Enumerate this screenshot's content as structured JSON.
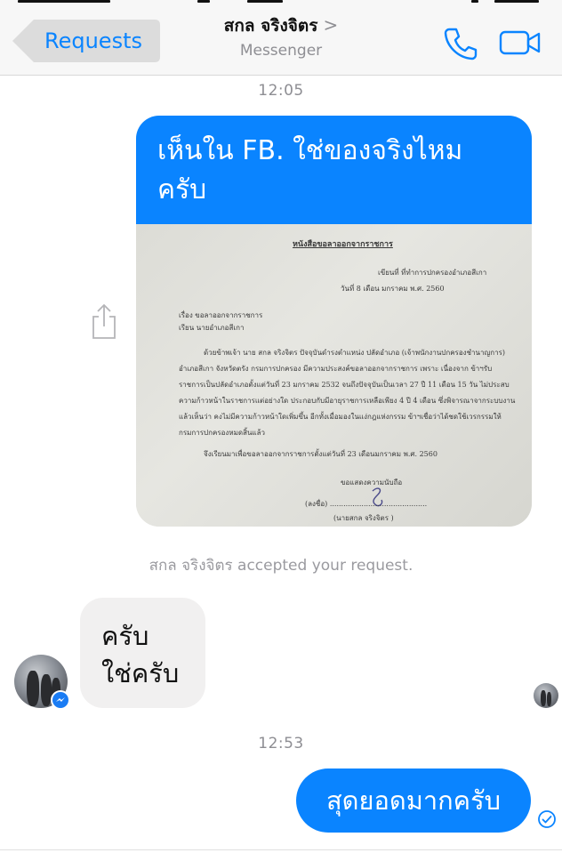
{
  "navbar": {
    "back_label": "Requests",
    "contact_name": "สกล จริงจิตร",
    "chevron": ">",
    "subtitle": "Messenger",
    "call_icon": "phone-icon",
    "video_icon": "video-camera-icon"
  },
  "conversation": {
    "timestamp_1": "12:05",
    "photo_message": {
      "caption": "เห็นใน FB. ใช่ของจริงไหมครับ",
      "document_lines": [
        "หนังสือขอลาออกจากราชการ",
        "เขียนที่ ที่ทำการปกครองอำเภอสีเกา",
        "วันที่ 8 เดือน มกราคม พ.ศ. 2560",
        "เรื่อง  ขอลาออกจากราชการ",
        "เรียน  นายอำเภอสีเกา",
        "ด้วยข้าพเจ้า นาย สกล จริงจิตร ปัจจุบันดำรงตำแหน่ง ปลัดอำเภอ (เจ้าพนักงานปกครองชำนาญการ)",
        "อำเภอสีเกา จังหวัดตรัง กรมการปกครอง  มีความประสงค์ขอลาออกจากราชการ  เพราะ เนื่องจาก ข้าฯรับ",
        "ราชการเป็นปลัดอำเภอตั้งแต่วันที่ 23 มกราคม 2532 จนถึงปัจจุบันเป็นเวลา 27 ปี 11 เดือน 15 วัน ไม่ประสบ",
        "ความก้าวหน้าในราชการแต่อย่างใด ประกอบกับมีอายุราชการเหลือเพียง 4 ปี 4 เดือน ซึ่งพิจารณาจากระบบงาน",
        "แล้วเห็นว่า คงไม่มีความก้าวหน้าใดเพิ่มขึ้น อีกทั้งเมื่อมองในแง่กฎแห่งกรรม ข้าฯเชื่อว่าได้ชดใช้เวรกรรมให้",
        "กรมการปกครองหมดสิ้นแล้ว",
        "จึงเรียนมาเพื่อขอลาออกจากราชการตั้งแต่วันที่ 23 เดือนมกราคม พ.ศ. 2560",
        "ขอแสดงความนับถือ",
        "(ลงชื่อ) ...........................................",
        "(นายสกล  จริงจิตร )"
      ]
    },
    "share_icon": "share-icon",
    "system_note": "สกล จริงจิตร accepted your request.",
    "incoming_message": {
      "line1": "ครับ",
      "line2": "ใช่ครับ"
    },
    "timestamp_2": "12:53",
    "outgoing_message": "สุดยอดมากครับ",
    "colors": {
      "accent": "#0a84ff",
      "incoming_bubble": "#f1f0f0",
      "meta_text": "#8e8e93"
    }
  }
}
